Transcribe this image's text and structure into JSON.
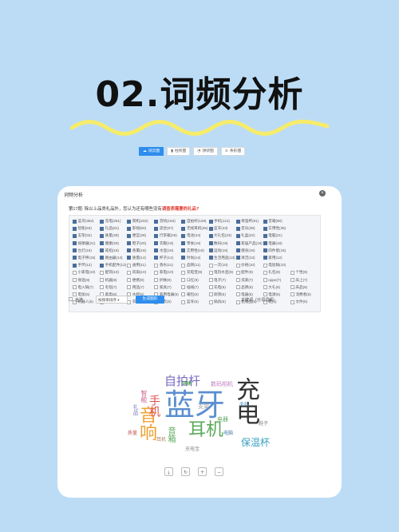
{
  "heading": "02.词频分析",
  "window": {
    "title": "词频分析",
    "close_icon": "close-icon",
    "question_prefix": "第17题: 除以上品类礼品外，您认为还有哪些没有",
    "question_highlight": "调查表需要的礼品?",
    "words": [
      {
        "label": "蓝牙(352)",
        "checked": true
      },
      {
        "label": "充电(251)",
        "checked": true
      },
      {
        "label": "耳机(202)",
        "checked": true
      },
      {
        "label": "音响(184)",
        "checked": true
      },
      {
        "label": "自拍杆(128)",
        "checked": true
      },
      {
        "label": "手机(121)",
        "checked": true
      },
      {
        "label": "保温杯(91)",
        "checked": true
      },
      {
        "label": "音箱(90)",
        "checked": true
      },
      {
        "label": "",
        "checked": false
      },
      {
        "label": "智能(63)",
        "checked": true
      },
      {
        "label": "礼品(61)",
        "checked": true
      },
      {
        "label": "影视(50)",
        "checked": true
      },
      {
        "label": "适合(57)",
        "checked": true
      },
      {
        "label": "无线耳机(45)",
        "checked": true
      },
      {
        "label": "蓝牙(43)",
        "checked": true
      },
      {
        "label": "音乐(39)",
        "checked": true
      },
      {
        "label": "实用性(35)",
        "checked": true
      },
      {
        "label": "",
        "checked": false
      },
      {
        "label": "支架(32)",
        "checked": true
      },
      {
        "label": "质量(29)",
        "checked": true
      },
      {
        "label": "便宜(28)",
        "checked": true
      },
      {
        "label": "行李箱(25)",
        "checked": true
      },
      {
        "label": "电池(24)",
        "checked": true
      },
      {
        "label": "大礼包(23)",
        "checked": true
      },
      {
        "label": "礼盒(22)",
        "checked": true
      },
      {
        "label": "电脑(21)",
        "checked": true
      },
      {
        "label": "",
        "checked": false
      },
      {
        "label": "按摩器(21)",
        "checked": true
      },
      {
        "label": "健康(20)",
        "checked": true
      },
      {
        "label": "鞋子(20)",
        "checked": true
      },
      {
        "label": "衣服(19)",
        "checked": true
      },
      {
        "label": "零食(19)",
        "checked": true
      },
      {
        "label": "数码(18)",
        "checked": true
      },
      {
        "label": "家居产品(18)",
        "checked": true
      },
      {
        "label": "电器(18)",
        "checked": true
      },
      {
        "label": "",
        "checked": false
      },
      {
        "label": "台灯(16)",
        "checked": true
      },
      {
        "label": "戒指(16)",
        "checked": true
      },
      {
        "label": "香薰(16)",
        "checked": true
      },
      {
        "label": "水壶(16)",
        "checked": true
      },
      {
        "label": "实用性(16)",
        "checked": true
      },
      {
        "label": "运动(16)",
        "checked": true
      },
      {
        "label": "健身(16)",
        "checked": true
      },
      {
        "label": "四件套(15)",
        "checked": true
      },
      {
        "label": "",
        "checked": false
      },
      {
        "label": "电子秤(15)",
        "checked": true
      },
      {
        "label": "路由器(14)",
        "checked": true
      },
      {
        "label": "质量(14)",
        "checked": true
      },
      {
        "label": "杯子(14)",
        "checked": true
      },
      {
        "label": "时尚(14)",
        "checked": true
      },
      {
        "label": "生活用品(13)",
        "checked": true
      },
      {
        "label": "清洁(13)",
        "checked": true
      },
      {
        "label": "家用(12)",
        "checked": true
      },
      {
        "label": "",
        "checked": false
      },
      {
        "label": "手环(12)",
        "checked": true
      },
      {
        "label": "手机配件(12)",
        "checked": true
      },
      {
        "label": "通用(11)",
        "checked": false
      },
      {
        "label": "香水(11)",
        "checked": false
      },
      {
        "label": "品牌(11)",
        "checked": false
      },
      {
        "label": "一次(10)",
        "checked": false
      },
      {
        "label": "价格(10)",
        "checked": false
      },
      {
        "label": "电饭锅(10)",
        "checked": false
      },
      {
        "label": "",
        "checked": false
      },
      {
        "label": "小家电(10)",
        "checked": false
      },
      {
        "label": "配饰(10)",
        "checked": false
      },
      {
        "label": "风扇(10)",
        "checked": false
      },
      {
        "label": "家电(10)",
        "checked": false
      },
      {
        "label": "充电宝(9)",
        "checked": false
      },
      {
        "label": "电热水壶(9)",
        "checked": false
      },
      {
        "label": "配件(9)",
        "checked": false
      },
      {
        "label": "礼包(9)",
        "checked": false
      },
      {
        "label": "个性(9)",
        "checked": false
      },
      {
        "label": "保温(9)",
        "checked": false
      },
      {
        "label": "机器(9)",
        "checked": false
      },
      {
        "label": "便携(9)",
        "checked": false
      },
      {
        "label": "护肤(9)",
        "checked": false
      },
      {
        "label": "口红(9)",
        "checked": false
      },
      {
        "label": "电子(7)",
        "checked": false
      },
      {
        "label": "洗漱(7)",
        "checked": false
      },
      {
        "label": "oppo(7)",
        "checked": false
      },
      {
        "label": "床上(7)",
        "checked": false
      },
      {
        "label": "电火锅(7)",
        "checked": false
      },
      {
        "label": "毛毯(7)",
        "checked": false
      },
      {
        "label": "用品(7)",
        "checked": false
      },
      {
        "label": "家具(7)",
        "checked": false
      },
      {
        "label": "插线(7)",
        "checked": false
      },
      {
        "label": "充电(6)",
        "checked": false
      },
      {
        "label": "品牌(6)",
        "checked": false
      },
      {
        "label": "大礼(6)",
        "checked": false
      },
      {
        "label": "床品(6)",
        "checked": false
      },
      {
        "label": "电饭(5)",
        "checked": false
      },
      {
        "label": "家电(5)",
        "checked": false
      },
      {
        "label": "水杯(5)",
        "checked": false
      },
      {
        "label": "家用电器(5)",
        "checked": false
      },
      {
        "label": "箱包(5)",
        "checked": false
      },
      {
        "label": "剃须(5)",
        "checked": false
      },
      {
        "label": "电器(5)",
        "checked": false
      },
      {
        "label": "电源(5)",
        "checked": false
      },
      {
        "label": "消费者(5)",
        "checked": false
      },
      {
        "label": "机器人(5)",
        "checked": false
      },
      {
        "label": "智能(5)",
        "checked": false
      },
      {
        "label": "衣物(5)",
        "checked": false
      },
      {
        "label": "洗衣(5)",
        "checked": false
      },
      {
        "label": "蓝牙(5)",
        "checked": false
      },
      {
        "label": "锅具(5)",
        "checked": false
      },
      {
        "label": "化妆品(5)",
        "checked": false
      },
      {
        "label": "鞋(5)",
        "checked": false
      },
      {
        "label": "文件(5)",
        "checked": false
      }
    ],
    "select_all_label": "全选",
    "sort_select": "按频率排序",
    "generate_button": "生成图形",
    "right_label": "关键词（分词词频）",
    "tabs": [
      {
        "label": "词云图",
        "icon": "cloud-icon",
        "active": true
      },
      {
        "label": "柱状图",
        "icon": "bar-chart-icon",
        "active": false
      },
      {
        "label": "饼状图",
        "icon": "pie-chart-icon",
        "active": false
      },
      {
        "label": "条形图",
        "icon": "list-chart-icon",
        "active": false
      }
    ],
    "cloud_words": [
      {
        "text": "蓝牙",
        "color": "#5b8fd0"
      },
      {
        "text": "充电",
        "color": "#333333"
      },
      {
        "text": "耳机",
        "color": "#5aaa5a"
      },
      {
        "text": "音响",
        "color": "#f0a030"
      },
      {
        "text": "自拍杆",
        "color": "#7a6abf"
      },
      {
        "text": "手机",
        "color": "#e05050"
      },
      {
        "text": "保温杯",
        "color": "#3aa0c0"
      },
      {
        "text": "音箱",
        "color": "#5aaa5a"
      },
      {
        "text": "智能",
        "color": "#d06090"
      },
      {
        "text": "礼品",
        "color": "#8080c0"
      },
      {
        "text": "数码相机",
        "color": "#c080c0"
      },
      {
        "text": "支架",
        "color": "#a0a0a0"
      },
      {
        "text": "电器",
        "color": "#6aaa6a"
      },
      {
        "text": "耳机",
        "color": "#b08060"
      },
      {
        "text": "充电宝",
        "color": "#8a8a8a"
      },
      {
        "text": "电脑",
        "color": "#4a7ab0"
      },
      {
        "text": "质量",
        "color": "#c06060"
      },
      {
        "text": "鞋子",
        "color": "#808080"
      },
      {
        "text": "无线",
        "color": "#5090c0"
      },
      {
        "text": "健康",
        "color": "#40a040"
      }
    ],
    "toolbar": [
      "download-icon",
      "refresh-icon",
      "zoom-in-icon",
      "zoom-out-icon"
    ]
  }
}
